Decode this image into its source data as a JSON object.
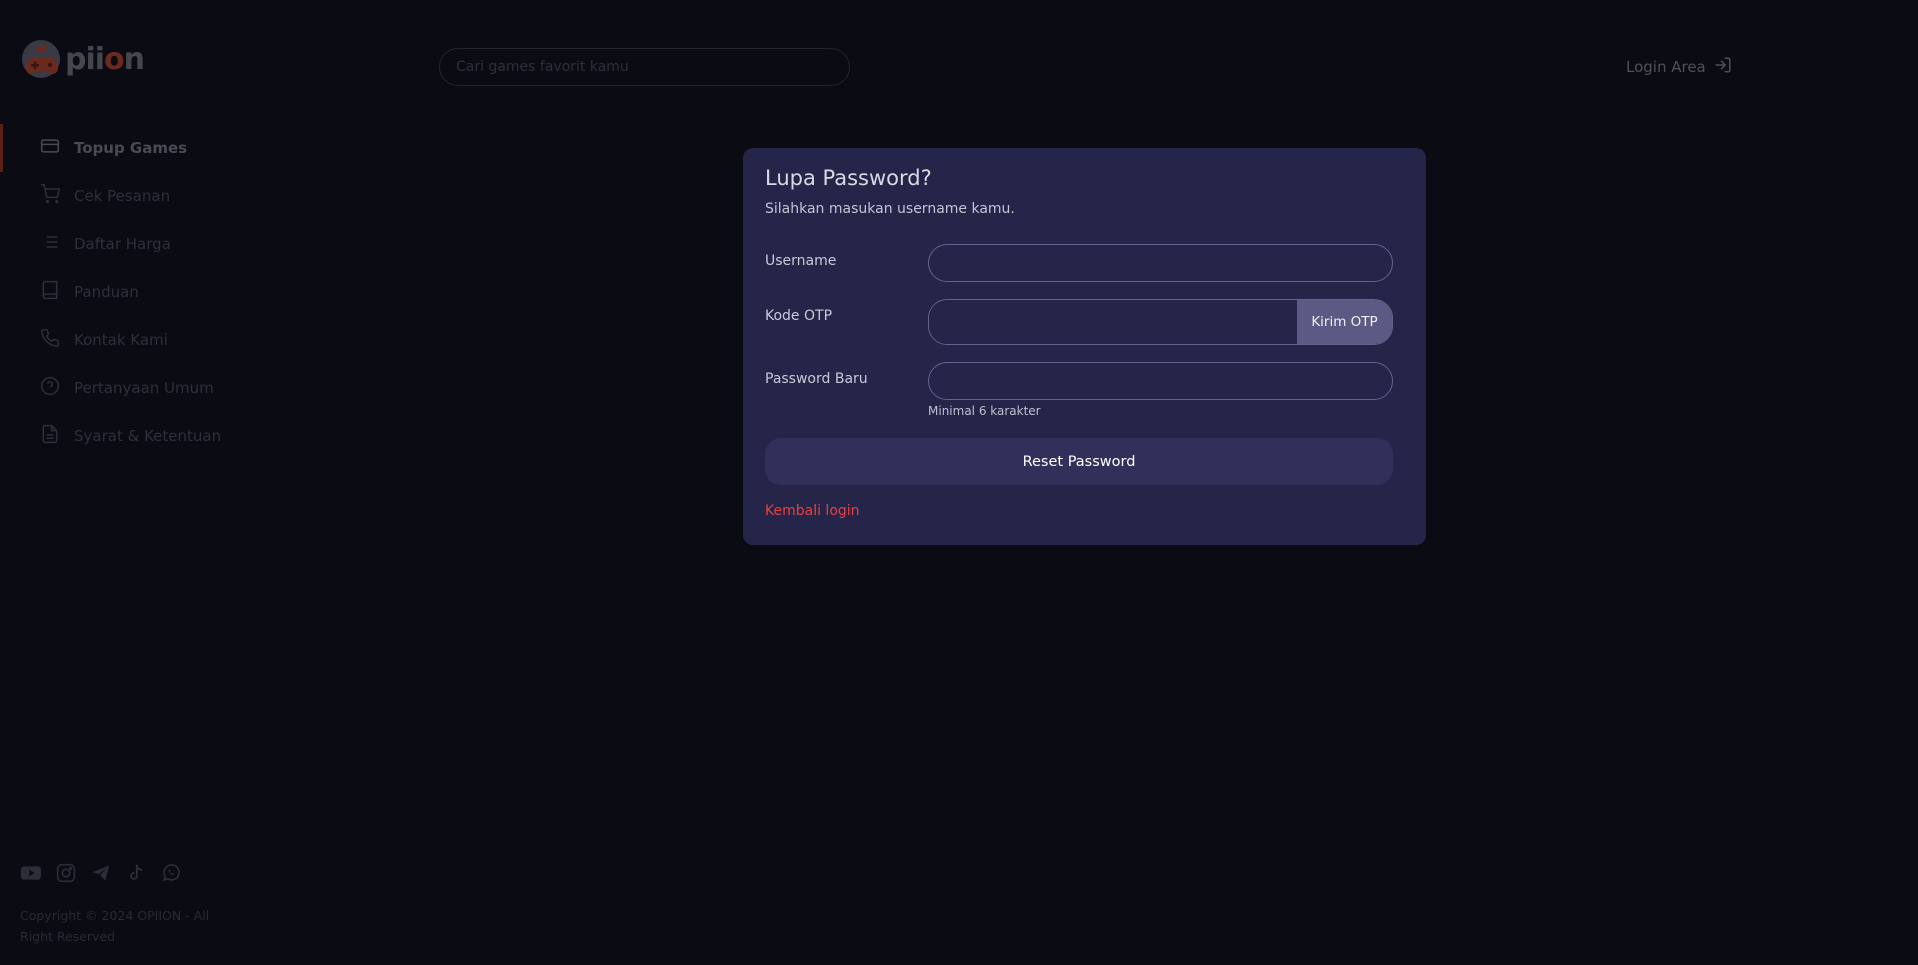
{
  "brand": {
    "name_prefix": "pii",
    "name_o": "o",
    "name_suffix": "n"
  },
  "search": {
    "placeholder": "Cari games favorit kamu"
  },
  "header": {
    "login_label": "Login Area"
  },
  "sidebar": {
    "items": [
      {
        "label": "Topup Games",
        "icon": "credit-card-icon",
        "active": true
      },
      {
        "label": "Cek Pesanan",
        "icon": "cart-icon"
      },
      {
        "label": "Daftar Harga",
        "icon": "list-icon"
      },
      {
        "label": "Panduan",
        "icon": "book-icon"
      },
      {
        "label": "Kontak Kami",
        "icon": "phone-icon"
      },
      {
        "label": "Pertanyaan Umum",
        "icon": "help-circle-icon"
      },
      {
        "label": "Syarat & Ketentuan",
        "icon": "document-icon"
      }
    ]
  },
  "footer": {
    "socials": [
      "youtube-icon",
      "instagram-icon",
      "telegram-icon",
      "tiktok-icon",
      "whatsapp-icon"
    ],
    "copyright": "Copyright © 2024 OPIION - All Right Reserved"
  },
  "form": {
    "title": "Lupa Password?",
    "subtitle": "Silahkan masukan username kamu.",
    "username_label": "Username",
    "username_value": "",
    "otp_label": "Kode OTP",
    "otp_value": "",
    "send_otp_label": "Kirim OTP",
    "password_label": "Password Baru",
    "password_value": "",
    "password_hint": "Minimal 6 karakter",
    "submit_label": "Reset Password",
    "back_label": "Kembali login"
  },
  "colors": {
    "background": "#0b0b14",
    "card": "#25254a",
    "accent": "#e8413d",
    "button": "#30305a",
    "otp_button": "#5a5a84"
  }
}
